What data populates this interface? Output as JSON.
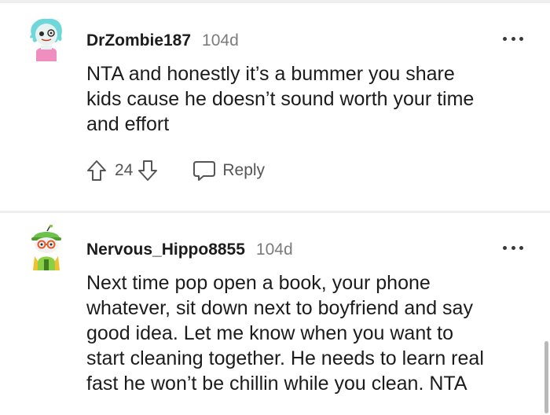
{
  "comments": [
    {
      "username": "DrZombie187",
      "age": "104d",
      "avatar_icon": "zombie-snoo-avatar-icon",
      "more_icon": "more-options-icon",
      "lines": [
        "NTA and honestly it’s a bummer you share",
        "kids cause he doesn’t sound worth your time",
        "and effort"
      ],
      "score": "24",
      "reply_label": "Reply"
    },
    {
      "username": "Nervous_Hippo8855",
      "age": "104d",
      "avatar_icon": "green-cap-snoo-avatar-icon",
      "more_icon": "more-options-icon",
      "lines": [
        "Next time pop open a book, your phone",
        "whatever, sit down next to boyfriend and say",
        "good idea. Let me know when you want to",
        "start cleaning together. He needs to learn real",
        "fast he won’t be chillin while you clean. NTA"
      ]
    }
  ],
  "colors": {
    "text": "#1c1c1c",
    "muted": "#7c7c7c",
    "divider": "#edeff1",
    "action": "#555555"
  }
}
